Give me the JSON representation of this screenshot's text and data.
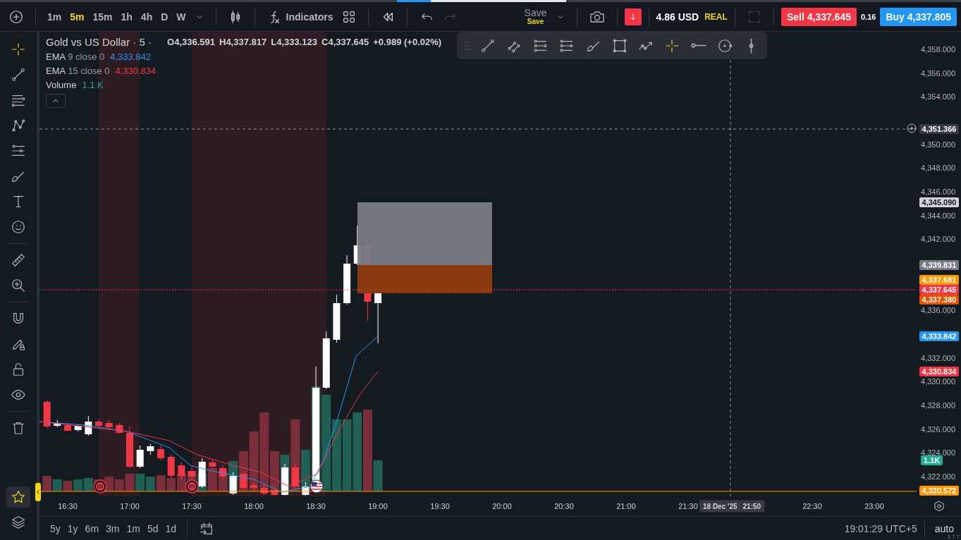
{
  "top_bar": {
    "intervals": [
      {
        "label": "1m",
        "selected": false
      },
      {
        "label": "5m",
        "selected": true
      },
      {
        "label": "15m",
        "selected": false
      },
      {
        "label": "1h",
        "selected": false
      },
      {
        "label": "4h",
        "selected": false
      },
      {
        "label": "D",
        "selected": false
      },
      {
        "label": "W",
        "selected": false
      }
    ],
    "indicators": "Indicators",
    "redo": {
      "disabled": true
    },
    "save": {
      "label": "Save",
      "status": "Save"
    },
    "balance": {
      "amount": "4.86 USD",
      "account": "REAL"
    },
    "sell": {
      "label": "Sell 4,337.645"
    },
    "spread": "0.16",
    "buy": {
      "label": "Buy 4,337.805"
    }
  },
  "left_toolbar": {
    "tools": [
      {
        "selected": true
      },
      {
        "selected": false
      },
      {
        "selected": false
      },
      {
        "selected": false
      },
      {
        "selected": false
      },
      {
        "selected": false
      },
      {
        "selected": false
      },
      {
        "selected": false
      },
      {
        "selected": false
      },
      {
        "selected": false
      },
      {
        "selected": false
      },
      {
        "selected": false
      },
      {
        "selected": false
      },
      {
        "selected": false
      },
      {
        "selected": false
      }
    ],
    "favorites": {
      "selected": true
    }
  },
  "legend": {
    "symbol": "Gold vs US Dollar · 5 ·",
    "ohlc": [
      "O4,336.591",
      "H4,337.817",
      "L4,333.123",
      "C4,337.645"
    ],
    "change": "+0.989 (+0.02%)",
    "indicators": [
      {
        "name": "EMA",
        "params": "9 close 0",
        "value": "4,333.842",
        "color": "#2196f3"
      },
      {
        "name": "EMA",
        "params": "15 close 0",
        "value": "4,330.834",
        "color": "#f23645"
      },
      {
        "name": "Volume",
        "value": "1.1 K",
        "color": "#22ab94"
      }
    ]
  },
  "drawing_toolbar": {
    "tools": [
      {
        "selected": false
      },
      {
        "selected": false
      },
      {
        "selected": false
      },
      {
        "selected": false
      },
      {
        "selected": false
      },
      {
        "selected": false
      },
      {
        "selected": false
      },
      {
        "selected": true
      },
      {
        "selected": false
      },
      {
        "selected": false
      },
      {
        "selected": false
      }
    ]
  },
  "price_axis": {
    "ticks": [
      "4,358.000",
      "4,356.000",
      "4,354.000",
      "4,350.000",
      "4,348.000",
      "4,346.000",
      "4,344.000",
      "4,342.000",
      "4,336.000",
      "4,332.000",
      "4,330.000",
      "4,328.000",
      "4,326.000",
      "4,324.000",
      "4,322.000"
    ],
    "badges": [
      {
        "kind": "crosshair",
        "text": "4,351.366",
        "color": "#363a45"
      },
      {
        "kind": "price",
        "text": "4,345.090",
        "color": "#d1d4dc"
      },
      {
        "kind": "price",
        "text": "4,339.831",
        "color": "#787b86"
      },
      {
        "kind": "price",
        "text": "4,337.681",
        "color": "#ff9800"
      },
      {
        "kind": "last",
        "text": "4,337.645",
        "color": "#f23645"
      },
      {
        "kind": "price",
        "text": "4,337.380",
        "color": "#e65100"
      },
      {
        "kind": "price",
        "text": "4,333.842",
        "color": "#2196f3"
      },
      {
        "kind": "price",
        "text": "4,330.834",
        "color": "#f23645"
      },
      {
        "kind": "volume",
        "text": "1.1K",
        "color": "#22ab94"
      },
      {
        "kind": "price",
        "text": "4,320.572",
        "color": "#ff9800"
      }
    ]
  },
  "time_axis": {
    "ticks": [
      "16:30",
      "17:00",
      "17:30",
      "18:00",
      "18:30",
      "19:00",
      "19:30",
      "20:00",
      "20:30",
      "21:00",
      "21:30",
      "22:30",
      "23:00"
    ],
    "crosshair": {
      "date": "18 Dec '25",
      "time": "21:50"
    }
  },
  "bottom_bar": {
    "ranges": [
      "5y",
      "1y",
      "6m",
      "3m",
      "1m",
      "5d",
      "1d"
    ],
    "clock": "19:01:29 UTC+5",
    "scale": "auto",
    "version": "3.7.7"
  }
}
